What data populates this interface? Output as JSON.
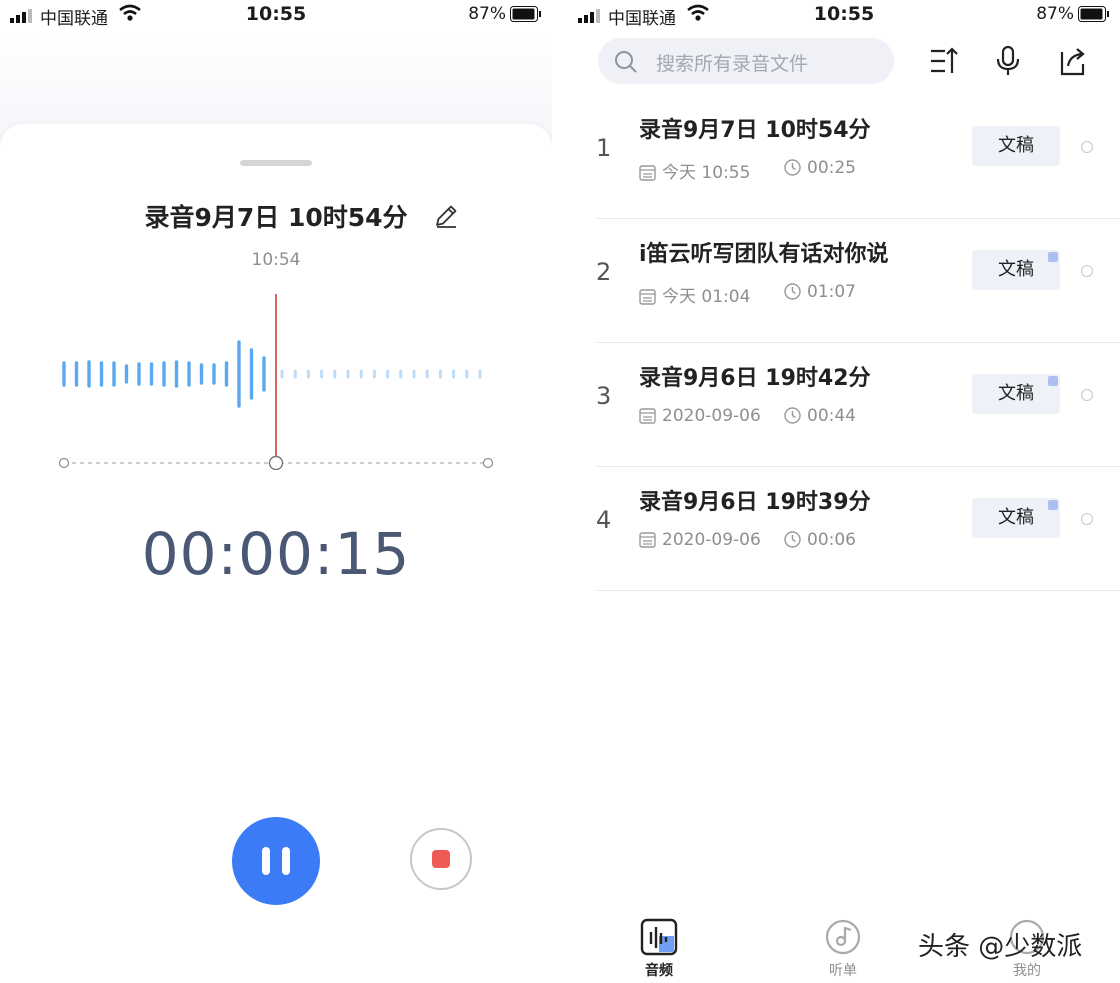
{
  "status_bar": {
    "carrier": "中国联通",
    "time": "10:55",
    "battery": "87%"
  },
  "recorder": {
    "title": "录音9月7日 10时54分",
    "start_time": "10:54",
    "timer": "00:00:15",
    "playhead_position": 0.5
  },
  "library": {
    "search_placeholder": "搜索所有录音文件",
    "recordings": [
      {
        "index": "1",
        "title": "录音9月7日 10时54分",
        "date": "今天 10:55",
        "duration": "00:25",
        "doc_label": "文稿",
        "doc_checked": false
      },
      {
        "index": "2",
        "title": "i笛云听写团队有话对你说",
        "date": "今天 01:04",
        "duration": "01:07",
        "doc_label": "文稿",
        "doc_checked": true
      },
      {
        "index": "3",
        "title": "录音9月6日 19时42分",
        "date": "2020-09-06",
        "duration": "00:44",
        "doc_label": "文稿",
        "doc_checked": true
      },
      {
        "index": "4",
        "title": "录音9月6日 19时39分",
        "date": "2020-09-06",
        "duration": "00:06",
        "doc_label": "文稿",
        "doc_checked": true
      }
    ],
    "tabs": [
      {
        "label": "音频",
        "icon": "audio-icon",
        "active": true
      },
      {
        "label": "听单",
        "icon": "music-disc-icon",
        "active": false
      },
      {
        "label": "我的",
        "icon": "profile-icon",
        "active": false
      }
    ]
  },
  "watermark": "头条 @少数派",
  "colors": {
    "accent": "#3b7cf6",
    "stop": "#ee5a55",
    "timer": "#4a5873",
    "playhead": "#c0392b",
    "wave": "#5aa9ef"
  }
}
